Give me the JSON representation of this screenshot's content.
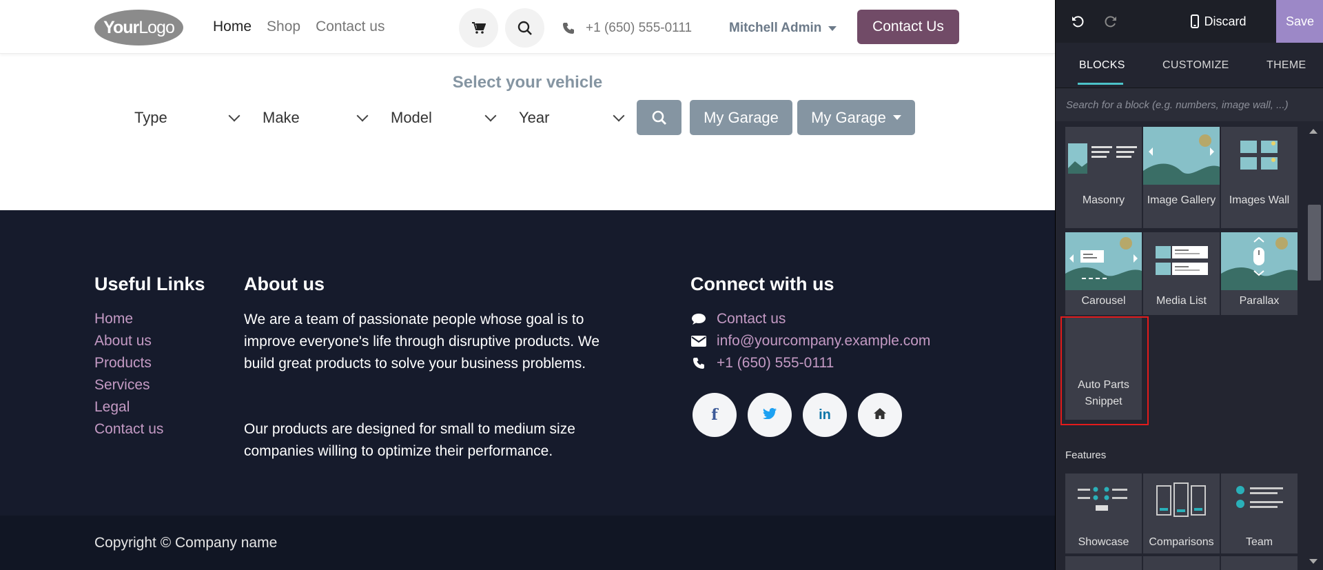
{
  "header": {
    "logo_text_bold": "Your",
    "logo_text": "Logo",
    "nav": [
      "Home",
      "Shop",
      "Contact us"
    ],
    "phone": "+1 (650) 555-0111",
    "user": "Mitchell Admin",
    "cta": "Contact Us"
  },
  "vehicle": {
    "title": "Select your vehicle",
    "selects": [
      "Type",
      "Make",
      "Model",
      "Year"
    ],
    "garage_1": "My Garage",
    "garage_2": "My Garage"
  },
  "footer": {
    "useful_title": "Useful Links",
    "useful_links": [
      "Home",
      "About us",
      "Products",
      "Services",
      "Legal",
      "Contact us"
    ],
    "about_title": "About us",
    "about_p1": "We are a team of passionate people whose goal is to improve everyone's life through disruptive products. We build great products to solve your business problems.",
    "about_p2": "Our products are designed for small to medium size companies willing to optimize their performance.",
    "connect_title": "Connect with us",
    "connect_contact": "Contact us",
    "connect_email": "info@yourcompany.example.com",
    "connect_phone": "+1 (650) 555-0111",
    "socials": [
      "f",
      "twitter",
      "in",
      "home"
    ],
    "copyright": "Copyright © Company name"
  },
  "editor": {
    "discard": "Discard",
    "save": "Save",
    "tabs": [
      "BLOCKS",
      "CUSTOMIZE",
      "THEME"
    ],
    "active_tab": "BLOCKS",
    "search_placeholder": "Search for a block (e.g. numbers, image wall, ...)",
    "blocks_row1": [
      "Masonry",
      "Image Gallery",
      "Images Wall"
    ],
    "blocks_row2": [
      "Carousel",
      "Media List",
      "Parallax"
    ],
    "block_custom": "Auto Parts Snippet",
    "features_label": "Features",
    "blocks_features": [
      "Showcase",
      "Comparisons",
      "Team"
    ]
  },
  "colors": {
    "brand": "#714b67",
    "accent": "#4cc3c9",
    "footer_bg": "#161b2c",
    "link": "#c49ac4",
    "save": "#9c88c7",
    "highlight": "#e31b1b"
  }
}
